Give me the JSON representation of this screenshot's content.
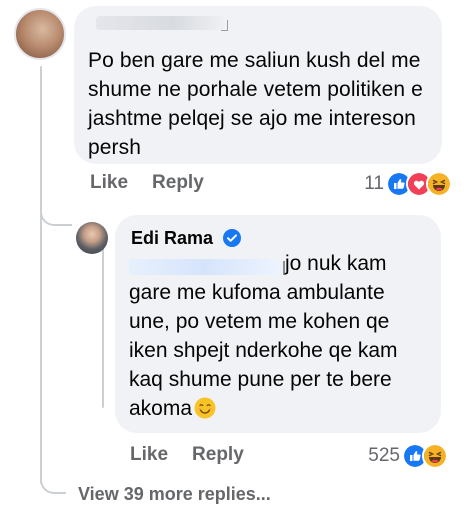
{
  "comment": {
    "text": "Po  ben gare me saliun kush del me shume ne porhale vetem politiken e jashtme pelqej se ajo me intereson persh",
    "like_label": "Like",
    "reply_label": "Reply",
    "reaction_count": "11",
    "reactions": [
      "like-icon",
      "love-icon",
      "haha-icon"
    ]
  },
  "reply": {
    "author": "Edi Rama",
    "text": "jo nuk kam gare me kufoma ambulante une, po vetem me kohen qe iken shpejt nderkohe qe kam kaq shume pune per te bere akoma",
    "like_label": "Like",
    "reply_label": "Reply",
    "reaction_count": "525",
    "reactions": [
      "like-icon",
      "haha-icon"
    ]
  },
  "view_more_replies": "View 39 more replies...",
  "colors": {
    "bubble": "#f0f2f5",
    "secondary_text": "#65676b",
    "like_blue": "#1877f2",
    "love_red": "#f33e58",
    "haha_yellow": "#f7b125"
  }
}
